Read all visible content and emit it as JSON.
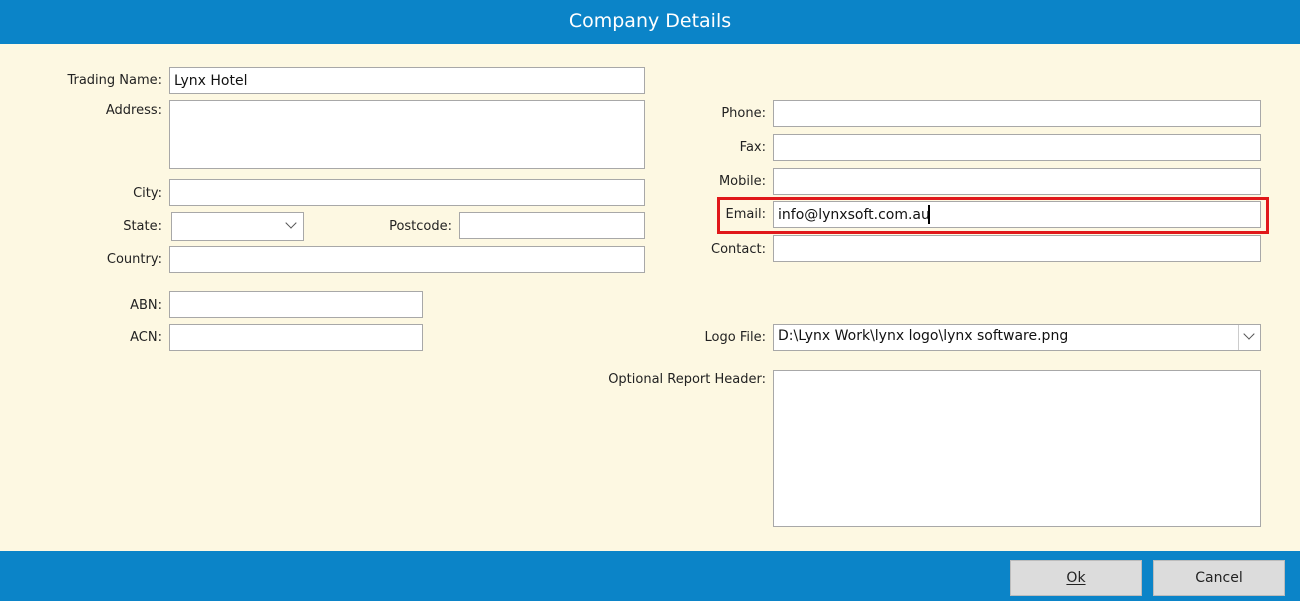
{
  "window": {
    "title": "Company Details"
  },
  "fields": {
    "trading_name": {
      "label": "Trading Name:",
      "value": "Lynx Hotel"
    },
    "address": {
      "label": "Address:",
      "value": ""
    },
    "city": {
      "label": "City:",
      "value": ""
    },
    "state": {
      "label": "State:",
      "value": ""
    },
    "postcode": {
      "label": "Postcode:",
      "value": ""
    },
    "country": {
      "label": "Country:",
      "value": ""
    },
    "abn": {
      "label": "ABN:",
      "value": ""
    },
    "acn": {
      "label": "ACN:",
      "value": ""
    },
    "phone": {
      "label": "Phone:",
      "value": ""
    },
    "fax": {
      "label": "Fax:",
      "value": ""
    },
    "mobile": {
      "label": "Mobile:",
      "value": ""
    },
    "email": {
      "label": "Email:",
      "value": "info@lynxsoft.com.au"
    },
    "contact": {
      "label": "Contact:",
      "value": ""
    },
    "logo_file": {
      "label": "Logo File:",
      "value": "D:\\Lynx Work\\lynx logo\\lynx software.png"
    },
    "report_header": {
      "label": "Optional Report Header:",
      "value": ""
    }
  },
  "buttons": {
    "ok": "Ok",
    "cancel": "Cancel"
  },
  "colors": {
    "titlebar": "#0b84c8",
    "form_background": "#fdf8e2",
    "highlight": "#e0181a"
  }
}
